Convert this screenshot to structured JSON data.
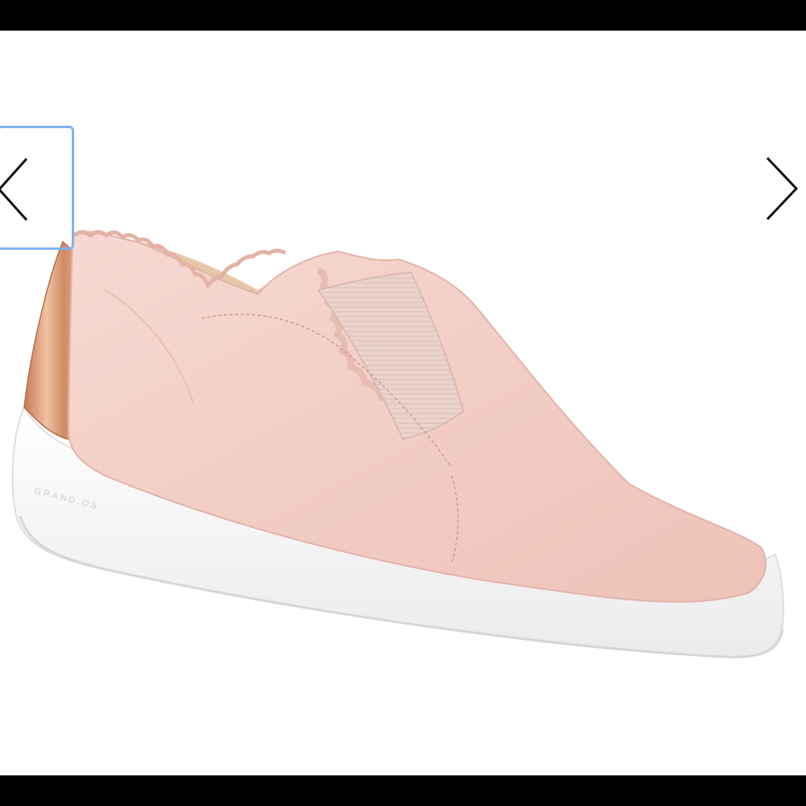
{
  "viewer": {
    "image_name": "product-photo-pink-slip-on-sneaker",
    "sole_brand_text": "GRAND.OS"
  },
  "navigation": {
    "prev_icon": "chevron-left-icon",
    "next_icon": "chevron-right-icon"
  },
  "colors": {
    "focus_ring": "#7fb2f0",
    "upper": "#f3d0c8",
    "sole": "#ffffff",
    "heel_tab": "#d8956e"
  }
}
